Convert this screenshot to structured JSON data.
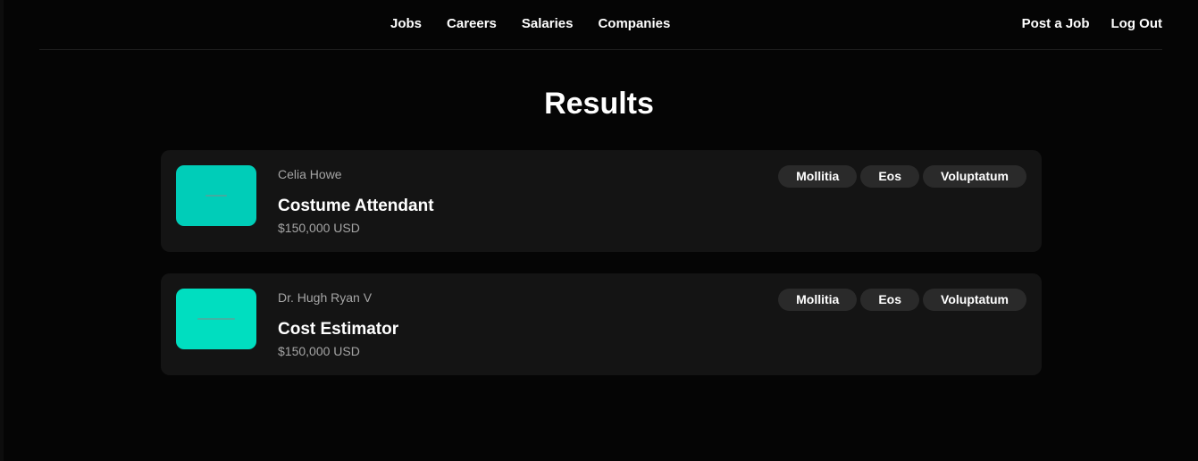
{
  "nav": {
    "center_links": [
      "Jobs",
      "Careers",
      "Salaries",
      "Companies"
    ],
    "right_links": [
      "Post a Job",
      "Log Out"
    ]
  },
  "page": {
    "title": "Results"
  },
  "results": [
    {
      "company": "Celia Howe",
      "title": "Costume Attendant",
      "salary": "$150,000 USD",
      "logo_color": "#00cdb8",
      "tags": [
        "Mollitia",
        "Eos",
        "Voluptatum"
      ]
    },
    {
      "company": "Dr. Hugh Ryan V",
      "title": "Cost Estimator",
      "salary": "$150,000 USD",
      "logo_color": "#00dec0",
      "tags": [
        "Mollitia",
        "Eos",
        "Voluptatum"
      ]
    }
  ],
  "colors": {
    "background": "#050505",
    "card": "#141414",
    "tag": "#2a2a2a",
    "muted_text": "#a5a5a5"
  }
}
